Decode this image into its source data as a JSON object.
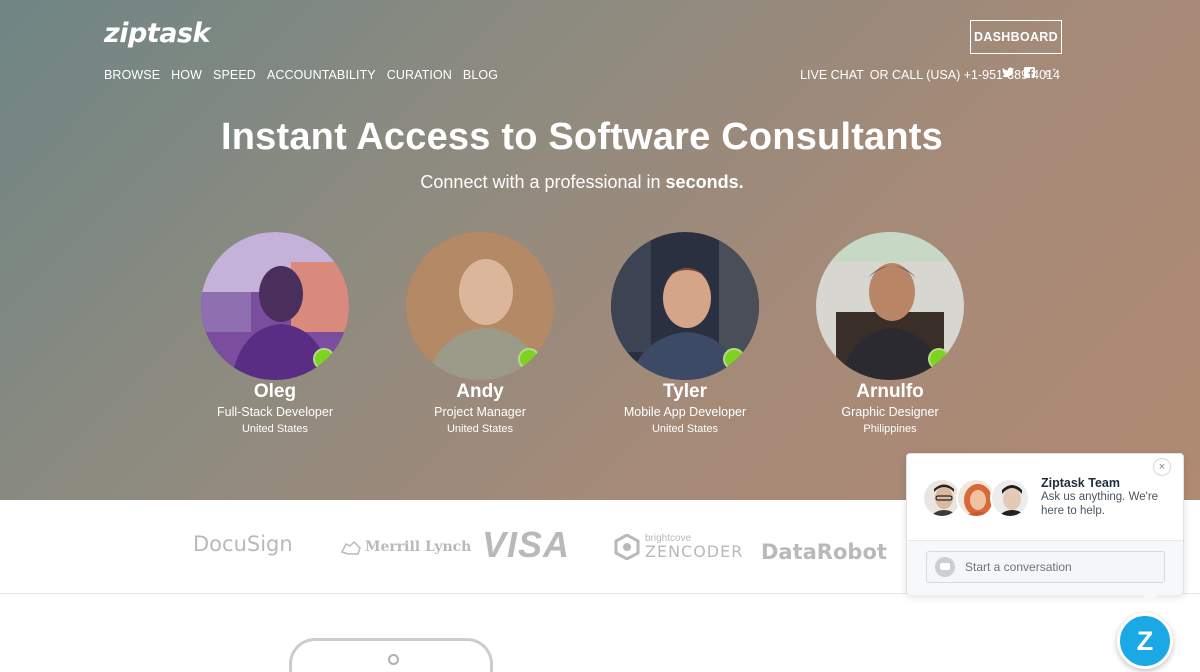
{
  "brand": {
    "logo_text": "ziptask"
  },
  "nav": {
    "items": [
      {
        "label": "BROWSE"
      },
      {
        "label": "HOW"
      },
      {
        "label": "SPEED"
      },
      {
        "label": "ACCOUNTABILITY"
      },
      {
        "label": "CURATION"
      },
      {
        "label": "BLOG"
      }
    ]
  },
  "header": {
    "dashboard_label": "DASHBOARD",
    "live_chat_label": "LIVE CHAT",
    "call_label": "OR CALL (USA) +1-951-389-4014",
    "social_icons": [
      "twitter-icon",
      "facebook-icon",
      "google-plus-icon"
    ]
  },
  "hero": {
    "headline_bold": "Instant Access",
    "headline_rest": " to Software Consultants",
    "sub_pre": "Connect with a professional in ",
    "sub_bold": "seconds."
  },
  "consultants": [
    {
      "name": "Oleg",
      "role": "Full-Stack Developer",
      "country": "United States",
      "status": "online"
    },
    {
      "name": "Andy",
      "role": "Project Manager",
      "country": "United States",
      "status": "online"
    },
    {
      "name": "Tyler",
      "role": "Mobile App Developer",
      "country": "United States",
      "status": "online"
    },
    {
      "name": "Arnulfo",
      "role": "Graphic Designer",
      "country": "Philippines",
      "status": "online"
    }
  ],
  "client_logos": [
    {
      "name": "DocuSign",
      "text": "DocuSign"
    },
    {
      "name": "Merrill Lynch",
      "text": "Merrill Lynch"
    },
    {
      "name": "VISA",
      "text": "VISA"
    },
    {
      "name": "brightcove ZENCODER",
      "small": "brightcove",
      "text": "ZENCODER"
    },
    {
      "name": "DataRobot",
      "text": "DataRobot"
    }
  ],
  "chat_widget": {
    "close_label": "×",
    "team_title": "Ziptask Team",
    "team_subtitle": "Ask us anything. We're here to help.",
    "input_placeholder": "Start a conversation",
    "launcher_label": "Z"
  },
  "colors": {
    "online": "#7ed321",
    "launcher": "#1ba9e6",
    "logo_gray": "#b7b9bb"
  }
}
